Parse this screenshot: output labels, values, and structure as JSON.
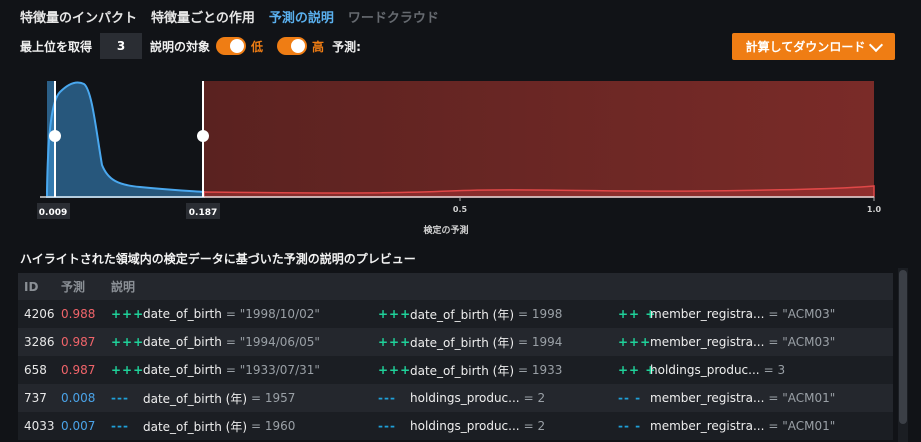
{
  "tabs": [
    {
      "label": "特徴量のインパクト"
    },
    {
      "label": "特徴量ごとの作用"
    },
    {
      "label": "予測の説明"
    },
    {
      "label": "ワードクラウド"
    }
  ],
  "controls": {
    "top_label": "最上位を取得",
    "top_value": "3",
    "target_label": "説明の対象",
    "low_label": "低",
    "high_label": "高",
    "prediction_label": "予測:"
  },
  "download_button": {
    "label": "計算してダウンロード"
  },
  "chart_data": {
    "type": "area",
    "xlim": [
      0,
      1
    ],
    "x_ticks": [
      "0.5",
      "1.0"
    ],
    "xlabel": "検定の予測",
    "low_threshold": "0.009",
    "high_threshold": "0.187",
    "colors": {
      "blue": "#3a8fd0",
      "red": "#8c2a2a",
      "highlight_low": "#2b5f87",
      "highlight_high": "#6b2622"
    }
  },
  "preview_title": "ハイライトされた領域内の検定データに基づいた予測の説明のプレビュー",
  "table": {
    "headers": {
      "id": "ID",
      "prediction": "予測",
      "explanation": "説明"
    },
    "rows": [
      {
        "id": "4206",
        "prediction": "0.988",
        "level": "high",
        "e": [
          {
            "sym": "+++",
            "name": "date_of_birth",
            "val": "= \"1998/10/02\""
          },
          {
            "sym": "+++",
            "name": "date_of_birth (年)",
            "val": "= 1998"
          },
          {
            "sym": "++ +",
            "name": "member_registra...",
            "val": "= \"ACM03\""
          }
        ]
      },
      {
        "id": "3286",
        "prediction": "0.987",
        "level": "high",
        "e": [
          {
            "sym": "+++",
            "name": "date_of_birth",
            "val": "= \"1994/06/05\""
          },
          {
            "sym": "+++",
            "name": "date_of_birth (年)",
            "val": "= 1994"
          },
          {
            "sym": "+++",
            "name": "member_registra...",
            "val": "= \"ACM03\""
          }
        ]
      },
      {
        "id": "658",
        "prediction": "0.987",
        "level": "high",
        "e": [
          {
            "sym": "+++",
            "name": "date_of_birth",
            "val": "= \"1933/07/31\""
          },
          {
            "sym": "+++",
            "name": "date_of_birth (年)",
            "val": "= 1933"
          },
          {
            "sym": "++ +",
            "name": "holdings_produc...",
            "val": "= 3"
          }
        ]
      },
      {
        "id": "737",
        "prediction": "0.008",
        "level": "low",
        "e": [
          {
            "sym": "---",
            "name": "date_of_birth (年)",
            "val": "= 1957"
          },
          {
            "sym": "---",
            "name": "holdings_produc...",
            "val": "= 2"
          },
          {
            "sym": "-- -",
            "name": "member_registra...",
            "val": "= \"ACM01\""
          }
        ]
      },
      {
        "id": "4033",
        "prediction": "0.007",
        "level": "low",
        "e": [
          {
            "sym": "---",
            "name": "date_of_birth (年)",
            "val": "= 1960"
          },
          {
            "sym": "---",
            "name": "holdings_produc...",
            "val": "= 2"
          },
          {
            "sym": "-- -",
            "name": "member_registra...",
            "val": "= \"ACM01\""
          }
        ]
      }
    ]
  }
}
